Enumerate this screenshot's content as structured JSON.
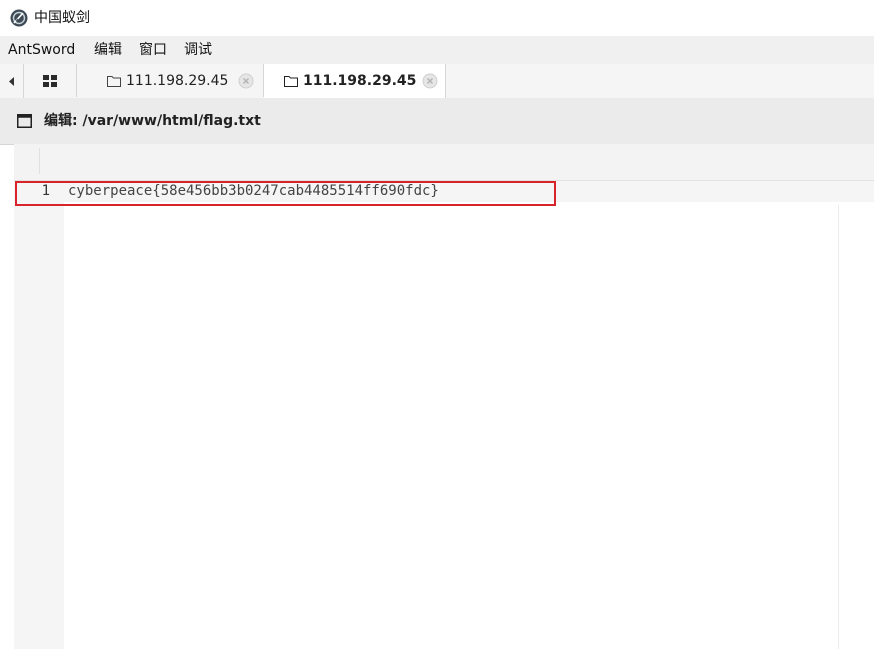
{
  "window": {
    "title": "中国蚁剑",
    "icon": "antsword-logo-icon"
  },
  "menubar": {
    "items": [
      "AntSword",
      "编辑",
      "窗口",
      "调试"
    ]
  },
  "tabs": {
    "items": [
      {
        "label": "111.198.29.45",
        "active": false
      },
      {
        "label": "111.198.29.45",
        "active": true
      }
    ]
  },
  "panel": {
    "title": "编辑: /var/www/html/flag.txt"
  },
  "editor": {
    "lines": [
      {
        "number": "1",
        "text": "cyberpeace{58e456bb3b0247cab4485514ff690fdc}"
      }
    ]
  },
  "colors": {
    "highlight_border": "#d9232a",
    "menubar_bg": "#f0f0f0",
    "panel_header_bg": "#ebebeb"
  }
}
